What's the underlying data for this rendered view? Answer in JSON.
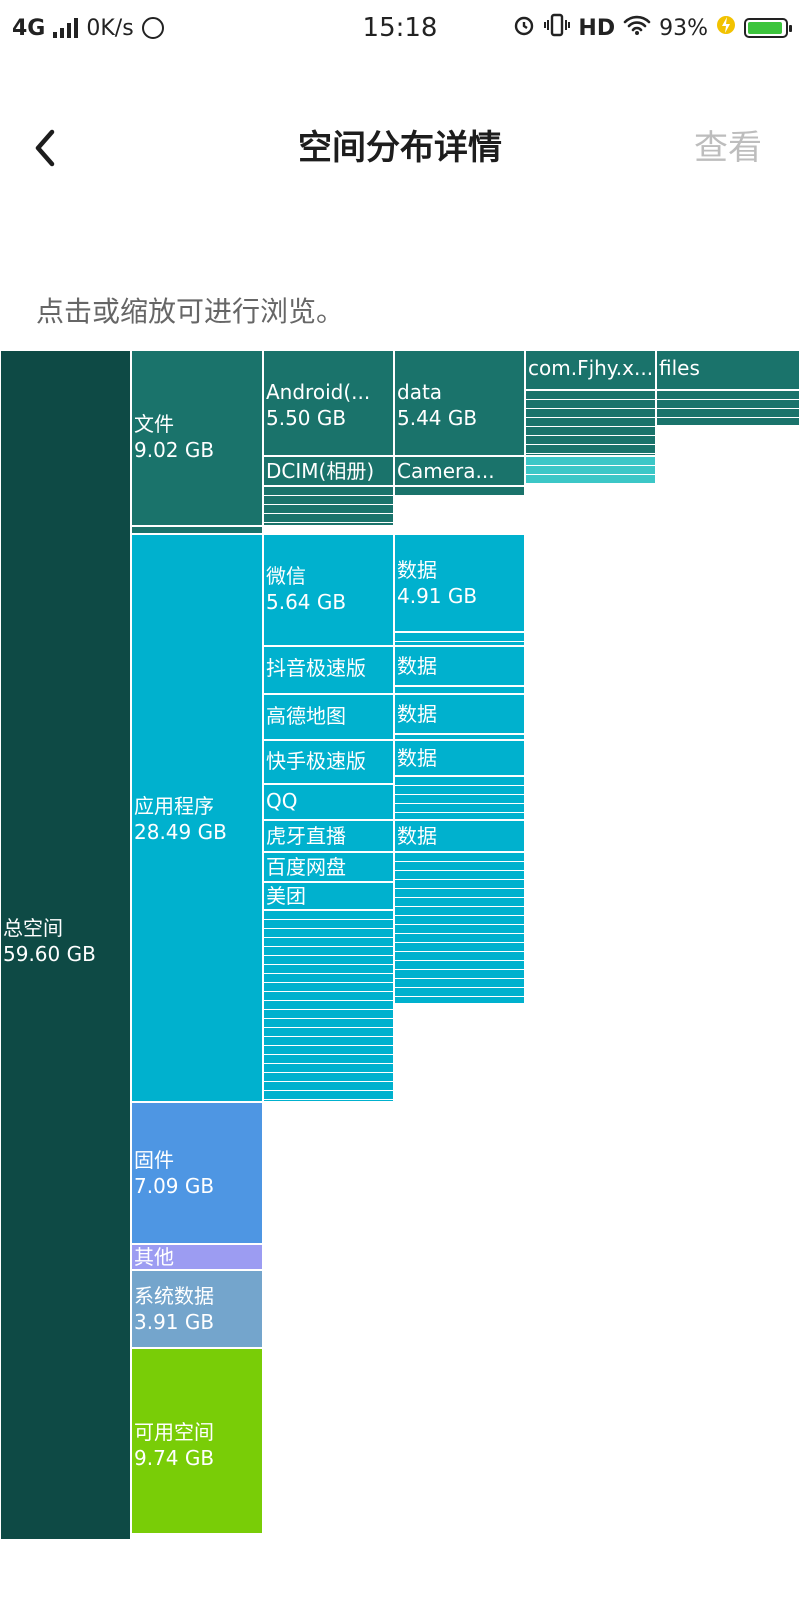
{
  "status_bar": {
    "network": "4G",
    "speed": "0K/s",
    "time": "15:18",
    "hd": "HD",
    "battery": "93%"
  },
  "header": {
    "title": "空间分布详情",
    "view_label": "查看",
    "back_icon": "chevron-left-icon"
  },
  "hint": "点击或缩放可进行浏览。",
  "treemap": {
    "total": {
      "name": "总空间",
      "size": "59.60 GB"
    },
    "files": {
      "name": "文件",
      "size": "9.02 GB"
    },
    "android": {
      "name": "Android(...",
      "size": "5.50 GB"
    },
    "android_data": {
      "name": "data",
      "size": "5.44 GB"
    },
    "com_pkg": {
      "name": "com.Fjhy.x..."
    },
    "pkg_files": {
      "name": "files"
    },
    "dcim": {
      "name": "DCIM(相册)"
    },
    "camera": {
      "name": "Camera..."
    },
    "apps": {
      "name": "应用程序",
      "size": "28.49 GB"
    },
    "wechat": {
      "name": "微信",
      "size": "5.64 GB"
    },
    "wechat_data": {
      "name": "数据",
      "size": "4.91 GB"
    },
    "douyin": {
      "name": "抖音极速版"
    },
    "douyin_data": {
      "name": "数据"
    },
    "gaode": {
      "name": "高德地图"
    },
    "gaode_data": {
      "name": "数据"
    },
    "kuaishou": {
      "name": "快手极速版"
    },
    "kuaishou_data": {
      "name": "数据"
    },
    "qq": {
      "name": "QQ"
    },
    "huya": {
      "name": "虎牙直播"
    },
    "huya_data": {
      "name": "数据"
    },
    "baidu": {
      "name": "百度网盘"
    },
    "meituan": {
      "name": "美团"
    },
    "firmware": {
      "name": "固件",
      "size": "7.09 GB"
    },
    "other": {
      "name": "其他"
    },
    "sysdata": {
      "name": "系统数据",
      "size": "3.91 GB"
    },
    "free": {
      "name": "可用空间",
      "size": "9.74 GB"
    }
  },
  "colors": {
    "total": "#0e4a45",
    "files": "#1a736b",
    "apps": "#00b1ce",
    "firmware": "#4e96e3",
    "other": "#9c9cf2",
    "sysdata": "#74a5cc",
    "free": "#79cd07"
  }
}
